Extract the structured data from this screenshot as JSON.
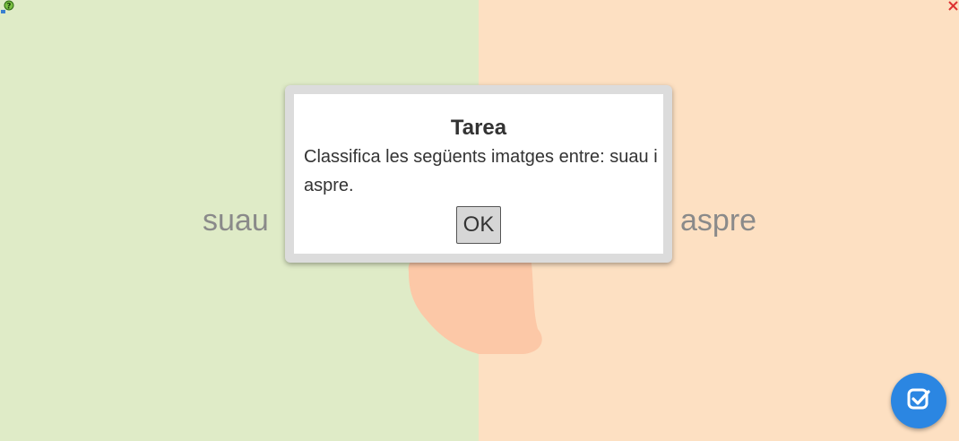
{
  "zones": {
    "left_label": "suau",
    "right_label": "aspre",
    "left_color": "#dfebc7",
    "right_color": "#fde0c2"
  },
  "dialog": {
    "title": "Tarea",
    "message": "Classifica les següents imatges entre: suau i aspre.",
    "ok_label": "OK"
  },
  "icons": {
    "top_left": "help-icon",
    "top_right": "close-icon",
    "bottom_right": "check-icon"
  },
  "accent_color": "#2b86e2"
}
